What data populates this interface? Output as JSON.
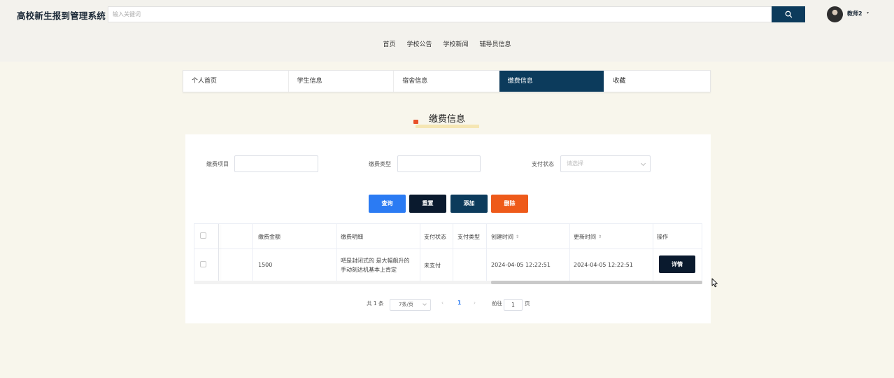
{
  "header": {
    "site_title": "高校新生报到管理系统",
    "search_placeholder": "输入关键词",
    "user_name": "教师2",
    "user_caret": "▾"
  },
  "nav": {
    "items": [
      "首页",
      "学校公告",
      "学校新闻",
      "辅导员信息"
    ]
  },
  "tabs": [
    {
      "label": "个人首页",
      "active": false
    },
    {
      "label": "学生信息",
      "active": false
    },
    {
      "label": "宿舍信息",
      "active": false
    },
    {
      "label": "缴费信息",
      "active": true
    },
    {
      "label": "收藏",
      "active": false
    }
  ],
  "section_title": "缴费信息",
  "filters": {
    "item_label": "缴费项目",
    "item_value": "",
    "type_label": "缴费类型",
    "type_value": "",
    "status_label": "支付状态",
    "status_placeholder": "请选择"
  },
  "buttons": {
    "query": "查询",
    "reset": "重置",
    "add": "添加",
    "delete": "删除",
    "colors": {
      "query": "#2b7bf3",
      "reset": "#0a1a2e",
      "add": "#0c3b5c",
      "delete": "#ee5a1a"
    }
  },
  "table": {
    "headers": {
      "amount": "缴费金额",
      "desc": "缴费明细",
      "pay_status": "支付状态",
      "pay_type": "支付类型",
      "created": "创建时间",
      "updated": "更新时间",
      "action": "操作"
    },
    "sort_icon": "⇕",
    "rows": [
      {
        "amount": "1500",
        "desc_line1": "吧是封闭式的 是大幅飙升的",
        "desc_line2": "手动刻达机基本上肯定",
        "pay_status": "未支付",
        "pay_type": "",
        "created": "2024-04-05 12:22:51",
        "updated": "2024-04-05 12:22:51",
        "action": "详情"
      }
    ]
  },
  "pagination": {
    "total": "共 1 条",
    "page_size": "7条/页",
    "prev": "‹",
    "current": "1",
    "next": "›",
    "goto_label": "前往",
    "goto_value": "1",
    "page_suffix": "页"
  },
  "icons": {
    "search": "search-icon",
    "cursor": "mouse-pointer-icon"
  },
  "colors": {
    "primary": "#0c3b5c",
    "page_bg": "#f8f6ec",
    "header_bg": "#f3f2ed",
    "accent": "#e8502a"
  }
}
